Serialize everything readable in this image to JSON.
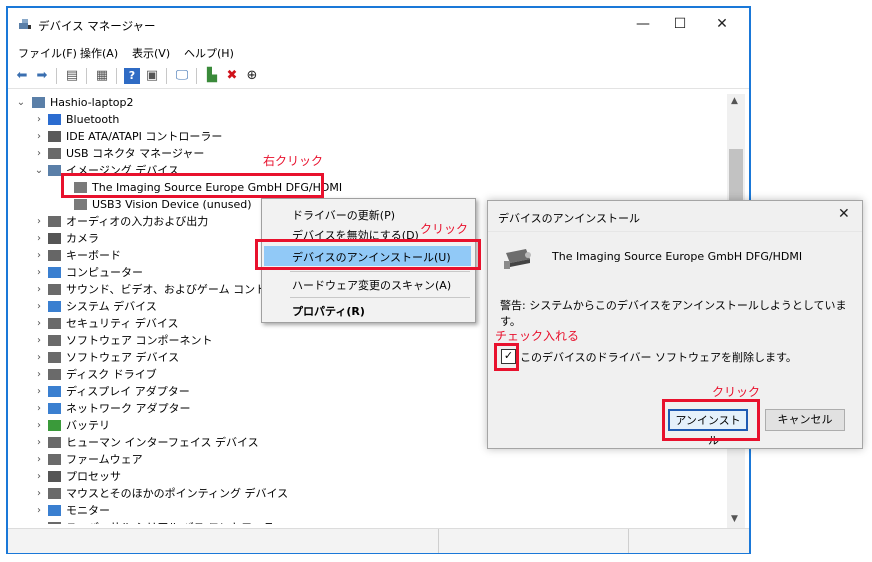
{
  "window": {
    "title": "デバイス マネージャー",
    "buttons": {
      "minimize": "—",
      "maximize": "☐",
      "close": "✕"
    }
  },
  "menubar": [
    "ファイル(F)",
    "操作(A)",
    "表示(V)",
    "ヘルプ(H)"
  ],
  "toolbar": [
    "back-icon",
    "forward-icon",
    "properties-icon",
    "list-icon",
    "help-icon",
    "view-icon",
    "monitor-icon",
    "enable-device-icon",
    "uninstall-icon",
    "update-driver-icon"
  ],
  "tree": {
    "root": "Hashio-laptop2",
    "items": [
      {
        "label": "Bluetooth",
        "expanded": false
      },
      {
        "label": "IDE ATA/ATAPI コントローラー",
        "expanded": false
      },
      {
        "label": "USB コネクタ マネージャー",
        "expanded": false
      },
      {
        "label": "イメージング デバイス",
        "expanded": true
      },
      {
        "label": "The Imaging Source Europe GmbH DFG/HDMI",
        "child": true
      },
      {
        "label": "USB3 Vision Device (unused)",
        "child": true
      },
      {
        "label": "オーディオの入力および出力",
        "expanded": false
      },
      {
        "label": "カメラ",
        "expanded": false
      },
      {
        "label": "キーボード",
        "expanded": false
      },
      {
        "label": "コンピューター",
        "expanded": false
      },
      {
        "label": "サウンド、ビデオ、およびゲーム コントローラー",
        "expanded": false
      },
      {
        "label": "システム デバイス",
        "expanded": false
      },
      {
        "label": "セキュリティ デバイス",
        "expanded": false
      },
      {
        "label": "ソフトウェア コンポーネント",
        "expanded": false
      },
      {
        "label": "ソフトウェア デバイス",
        "expanded": false
      },
      {
        "label": "ディスク ドライブ",
        "expanded": false
      },
      {
        "label": "ディスプレイ アダプター",
        "expanded": false
      },
      {
        "label": "ネットワーク アダプター",
        "expanded": false
      },
      {
        "label": "バッテリ",
        "expanded": false
      },
      {
        "label": "ヒューマン インターフェイス デバイス",
        "expanded": false
      },
      {
        "label": "ファームウェア",
        "expanded": false
      },
      {
        "label": "プロセッサ",
        "expanded": false
      },
      {
        "label": "マウスとそのほかのポインティング デバイス",
        "expanded": false
      },
      {
        "label": "モニター",
        "expanded": false
      },
      {
        "label": "ユニバーサル シリアル バス コントローラー",
        "expanded": false
      }
    ]
  },
  "context_menu": {
    "items": [
      "ドライバーの更新(P)",
      "デバイスを無効にする(D)",
      "デバイスのアンインストール(U)",
      "ハードウェア変更のスキャン(A)",
      "プロパティ(R)"
    ],
    "highlighted": "デバイスのアンインストール(U)"
  },
  "dialog": {
    "title": "デバイスのアンインストール",
    "close": "✕",
    "device_name": "The Imaging Source Europe GmbH DFG/HDMI",
    "warning": "警告: システムからこのデバイスをアンインストールしようとしています。",
    "checkbox_label": "このデバイスのドライバー ソフトウェアを削除します。",
    "checkbox_checked": true,
    "checkbox_mark": "✓",
    "uninstall_button": "アンインストール",
    "cancel_button": "キャンセル"
  },
  "annotations": {
    "right_click": "右クリック",
    "click1": "クリック",
    "check": "チェック入れる",
    "click2": "クリック",
    "color": "#e8112d"
  },
  "colors": {
    "window_border": "#1a78d8",
    "menu_highlight": "#91c9f7",
    "annotation": "#e8112d"
  }
}
